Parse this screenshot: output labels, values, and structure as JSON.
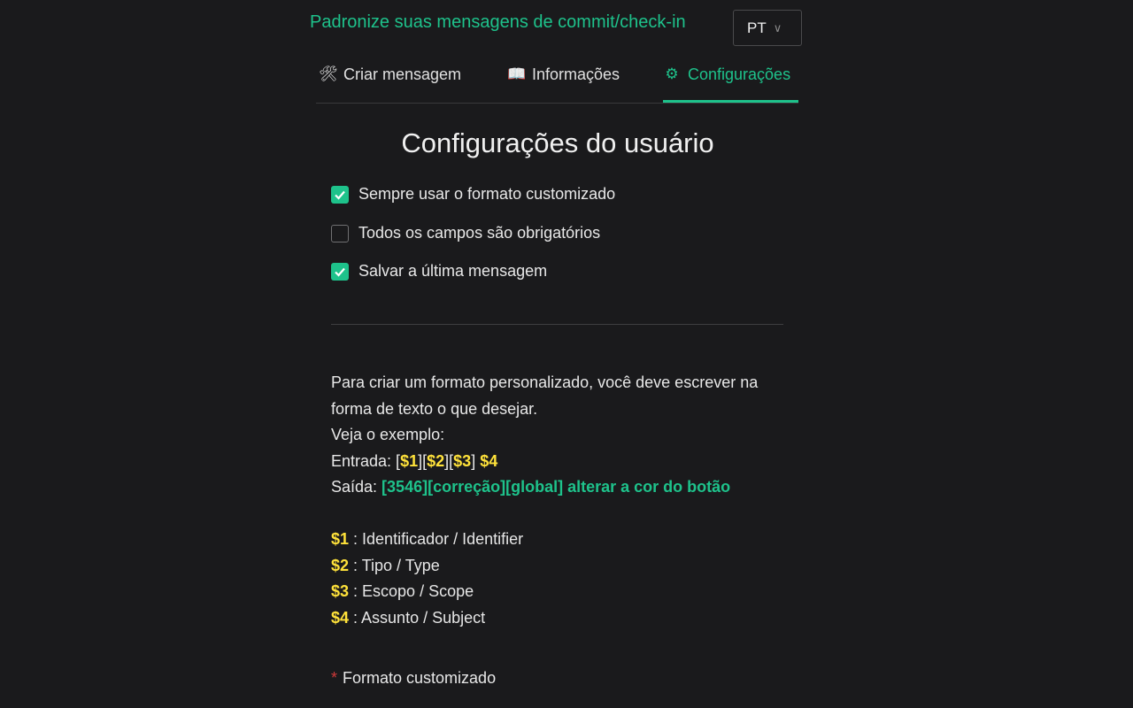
{
  "header": {
    "title": "Padronize suas mensagens de commit/check-in",
    "language": "PT"
  },
  "tabs": [
    {
      "label": "Criar mensagem",
      "icon": "tools-icon"
    },
    {
      "label": "Informações",
      "icon": "book-icon"
    },
    {
      "label": "Configurações",
      "icon": "gear-icon",
      "active": true
    }
  ],
  "settings": {
    "title": "Configurações do usuário",
    "options": [
      {
        "label": "Sempre usar o formato customizado",
        "checked": true
      },
      {
        "label": "Todos os campos são obrigatórios",
        "checked": false
      },
      {
        "label": "Salvar a última mensagem",
        "checked": true
      }
    ]
  },
  "info": {
    "line1": "Para criar um formato personalizado, você deve escrever na forma de texto o que desejar.",
    "line2": "Veja o exemplo:",
    "input_label": "Entrada: ",
    "input_parts": [
      "[",
      "$1",
      "][",
      "$2",
      "][",
      "$3",
      "] ",
      "$4"
    ],
    "output_label": "Saída: ",
    "output_value": "[3546][correção][global] alterar a cor do botão"
  },
  "legend": [
    {
      "key": "$1",
      "text": " : Identificador / Identifier"
    },
    {
      "key": "$2",
      "text": " : Tipo / Type"
    },
    {
      "key": "$3",
      "text": " : Escopo / Scope"
    },
    {
      "key": "$4",
      "text": " : Assunto / Subject"
    }
  ],
  "custom_format": {
    "required_mark": "*",
    "label": "Formato customizado"
  },
  "colors": {
    "accent": "#1ec28b",
    "highlight": "#ffe23a",
    "background": "#1a1a1c",
    "required": "#d03a3a"
  }
}
